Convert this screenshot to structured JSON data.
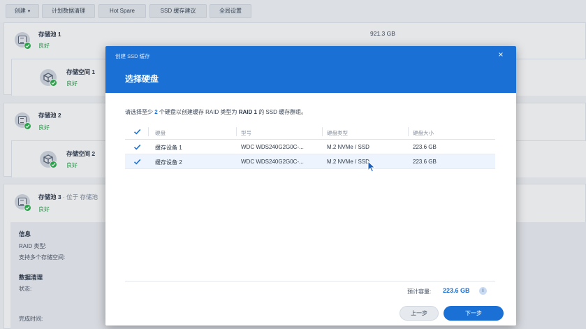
{
  "toolbar": {
    "create_label": "创建",
    "schedule_label": "计划数据清理",
    "hotspare_label": "Hot Spare",
    "ssd_advisor_label": "SSD 缓存建议",
    "global_settings_label": "全局设置"
  },
  "storage": {
    "pool1": {
      "title": "存储池 1",
      "status": "良好",
      "size": "921.3 GB"
    },
    "volume1": {
      "title": "存储空间 1",
      "status": "良好"
    },
    "pool2": {
      "title": "存储池 2",
      "status": "良好"
    },
    "volume2": {
      "title": "存储空间 2",
      "status": "良好"
    },
    "pool3": {
      "title": "存储池 3",
      "title_suffix": "· 位于 存储池",
      "status": "良好"
    },
    "info": {
      "heading": "信息",
      "raid_type_label": "RAID 类型:",
      "multi_volume_label": "支持多个存储空间:",
      "scrub_heading": "数据清理",
      "state_label": "状态:",
      "finish_time_label": "完成时间:"
    }
  },
  "dialog": {
    "window_title": "创建 SSD 缓存",
    "close_glyph": "×",
    "heading": "选择硬盘",
    "desc_prefix": "请选择至少",
    "desc_count": "2",
    "desc_middle": "个硬盘以创建缓存 RAID 类型为",
    "desc_raid": "RAID 1",
    "desc_suffix": "的 SSD 缓存群组。",
    "columns": {
      "drive": "硬盘",
      "model": "型号",
      "drive_type": "硬盘类型",
      "drive_size": "硬盘大小"
    },
    "rows": [
      {
        "drive": "缓存设备 1",
        "model": "WDC WDS240G2G0C-...",
        "type": "M.2 NVMe / SSD",
        "size": "223.6 GB",
        "checked": true
      },
      {
        "drive": "缓存设备 2",
        "model": "WDC WDS240G2G0C-...",
        "type": "M.2 NVMe / SSD",
        "size": "223.6 GB",
        "checked": true
      }
    ],
    "estimate_label": "预计容量:",
    "estimate_value": "223.6 GB",
    "info_glyph": "i",
    "prev_label": "上一步",
    "next_label": "下一步"
  },
  "colors": {
    "accent": "#1b70d6",
    "ok": "#2bb24c"
  },
  "icons": [
    "storage-pool-icon",
    "volume-icon",
    "ok-check-icon",
    "close-icon",
    "checkbox-checked-icon",
    "info-icon",
    "chevron-down-icon",
    "mouse-cursor-icon"
  ]
}
